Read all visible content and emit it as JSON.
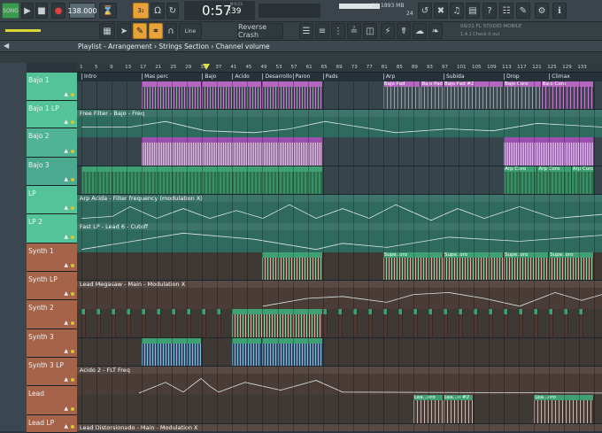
{
  "toolbar": {
    "mode_label": "SONG",
    "tempo": "138.000",
    "time_main": "0:57",
    "time_sub": ":39",
    "time_unit": "M:S:CS",
    "memory": "1893 MB",
    "cpu_left": "18",
    "cpu_right": "24",
    "fl_mobile_label": "09/21 FL STUDIO MOBILE",
    "fl_mobile_sub": "1.4.1 Check it out",
    "snap_label": "Line",
    "preset_label": "Reverse Crash"
  },
  "playlist": {
    "title": "Playlist - Arrangement › Strings Section › Channel volume"
  },
  "ruler": [
    "1",
    "5",
    "9",
    "13",
    "17",
    "21",
    "25",
    "29",
    "33",
    "37",
    "41",
    "45",
    "49",
    "53",
    "57",
    "61",
    "65",
    "69",
    "73",
    "77",
    "81",
    "85",
    "89",
    "93",
    "97",
    "101",
    "105",
    "109",
    "113",
    "117",
    "121",
    "125",
    "129",
    "133"
  ],
  "markers": [
    {
      "label": "Intro",
      "bar": 1
    },
    {
      "label": "Mas perc",
      "bar": 17
    },
    {
      "label": "Bajo",
      "bar": 33
    },
    {
      "label": "Acido",
      "bar": 41
    },
    {
      "label": "Desarrollo",
      "bar": 49
    },
    {
      "label": "Paron",
      "bar": 57
    },
    {
      "label": "Pads",
      "bar": 65
    },
    {
      "label": "Arp",
      "bar": 81
    },
    {
      "label": "Subida",
      "bar": 97
    },
    {
      "label": "Drop",
      "bar": 113
    },
    {
      "label": "Climax",
      "bar": 125
    }
  ],
  "tracks": [
    {
      "name": "Bajo 1",
      "color": "#55c39a",
      "h": 32
    },
    {
      "name": "Bajo 1 LP",
      "color": "#55c39a",
      "h": 31
    },
    {
      "name": "Bajo 2",
      "color": "#4fb394",
      "h": 33
    },
    {
      "name": "Bajo 3",
      "color": "#4aa98e",
      "h": 32
    },
    {
      "name": "LP",
      "color": "#55c39a",
      "h": 32
    },
    {
      "name": "LP 2",
      "color": "#55c39a",
      "h": 33
    },
    {
      "name": "Synth 1",
      "color": "#a5644a",
      "h": 32
    },
    {
      "name": "Synth LP",
      "color": "#a5644a",
      "h": 32
    },
    {
      "name": "Synth 2",
      "color": "#a5644a",
      "h": 33
    },
    {
      "name": "Synth 3",
      "color": "#a5644a",
      "h": 32
    },
    {
      "name": "Synth 3 LP",
      "color": "#a5644a",
      "h": 32
    },
    {
      "name": "Lead",
      "color": "#a5644a",
      "h": 33
    },
    {
      "name": "Lead LP",
      "color": "#a5644a",
      "h": 20
    }
  ],
  "clips": {
    "bajo_pad": "Bajo Pad",
    "bajo_pad2": "Bajo Pad #2",
    "bajo_coro": "Bajo Coro",
    "arp_coro": "Arp Coro",
    "supe": "Supe..oro",
    "lea": "Lea...oro",
    "lea2": "Lea...o #2"
  },
  "automation": {
    "free_filter": "Free Filter - Bajo - Freq",
    "arp_acida": "Arp Acida - Filter frequency (modulation X)",
    "fast_lp": "Fast LP - Lead 6 - Cutoff",
    "lead_megasaw": "Lead Megasaw - Main - Modulation X",
    "acido2": "Acido 2 - FLT Freq",
    "lead_dist": "Lead Distorsionado - Main - Modulation X"
  }
}
